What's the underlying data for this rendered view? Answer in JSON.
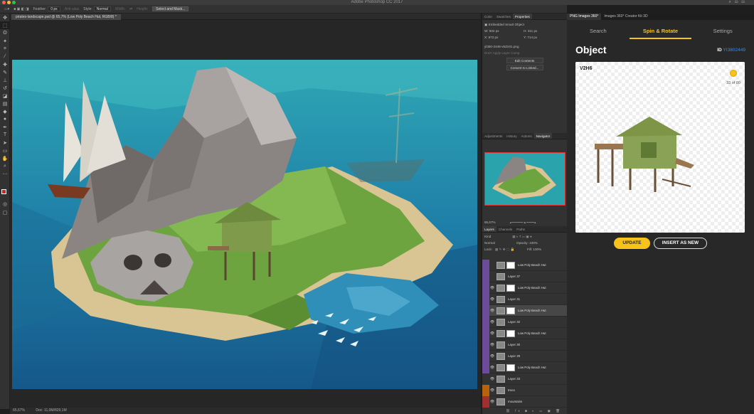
{
  "app": {
    "title": "Adobe Photoshop CC 2017"
  },
  "options_bar": {
    "feather_label": "Feather:",
    "feather_value": "0 px",
    "anti_alias_label": "Anti-alias",
    "style_label": "Style:",
    "style_value": "Normal",
    "width_label": "Width:",
    "height_label": "Height:",
    "select_mask_button": "Select and Mask..."
  },
  "document": {
    "tab_label": "pirates-landscape.psd @ 65,7% (Low Poly Beach Hut, RGB/8) *",
    "zoom": "65,67%",
    "doc_info": "Doc: 11,0M/829,1M"
  },
  "properties_panel": {
    "tabs": [
      "Color",
      "Swatches",
      "Properties"
    ],
    "active_tab": "Properties",
    "object_type": "Embedded Smart Object",
    "w": "W:  502 px",
    "h": "H:  311 px",
    "x": "X:  972 px",
    "y": "Y:  714 px",
    "filename": "yl360-2449-v5Zn01.png",
    "layer_comp_placeholder": "Don't Apply Layer Comp",
    "edit_contents": "Edit Contents",
    "convert_to_linked": "Convert to Linked..."
  },
  "navigator_panel": {
    "tabs": [
      "Adjustments",
      "History",
      "Actions",
      "Navigator"
    ],
    "active_tab": "Navigator",
    "zoom": "65,67%"
  },
  "layers_panel": {
    "tabs": [
      "Layers",
      "Channels",
      "Paths"
    ],
    "active_tab": "Layers",
    "kind_label": "Kind",
    "blend_mode": "Normal",
    "opacity_label": "Opacity:",
    "opacity_value": "100%",
    "lock_label": "Lock:",
    "fill_label": "Fill:",
    "fill_value": "100%",
    "layers": [
      {
        "name": "Low Poly Beach Hut",
        "color": "purple",
        "visible": false,
        "selected": false,
        "mask": true
      },
      {
        "name": "Layer 37",
        "color": "purple",
        "visible": false,
        "selected": false,
        "mask": false
      },
      {
        "name": "Low Poly Beach Hut",
        "color": "purple",
        "visible": true,
        "selected": false,
        "mask": true
      },
      {
        "name": "Layer 31",
        "color": "purple",
        "visible": true,
        "selected": false,
        "mask": false
      },
      {
        "name": "Low Poly Beach Hut",
        "color": "purple",
        "visible": true,
        "selected": true,
        "mask": true
      },
      {
        "name": "Layer 32",
        "color": "purple",
        "visible": true,
        "selected": false,
        "mask": false
      },
      {
        "name": "Low Poly Beach Hut",
        "color": "purple",
        "visible": true,
        "selected": false,
        "mask": true
      },
      {
        "name": "Layer 30",
        "color": "purple",
        "visible": true,
        "selected": false,
        "mask": false
      },
      {
        "name": "Layer 29",
        "color": "purple",
        "visible": true,
        "selected": false,
        "mask": false
      },
      {
        "name": "Low Poly Beach Hut",
        "color": "purple",
        "visible": true,
        "selected": false,
        "mask": true
      },
      {
        "name": "Layer 33",
        "color": "none",
        "visible": true,
        "selected": false,
        "mask": false
      },
      {
        "name": "trees",
        "color": "orange",
        "visible": true,
        "selected": false,
        "mask": false
      },
      {
        "name": "mountains",
        "color": "red",
        "visible": true,
        "selected": false,
        "mask": false
      }
    ],
    "colors": {
      "purple": "#6b4b9a",
      "orange": "#b8620e",
      "red": "#a03030",
      "none": "#323232"
    }
  },
  "plugin": {
    "window_tabs": [
      "PNG Images 360°",
      "Images 360° Creator Kit 3D"
    ],
    "nav": [
      "Search",
      "Spin & Rotate",
      "Settings"
    ],
    "active_nav": "Spin & Rotate",
    "heading": "Object",
    "id_label": "ID",
    "id_value": "YI3802449",
    "card_code": "V2H6",
    "count": "33 of 80",
    "update_button": "UPDATE",
    "insert_button": "INSERT AS NEW",
    "accent": "#f7c31a",
    "link_color": "#2e8bff"
  }
}
